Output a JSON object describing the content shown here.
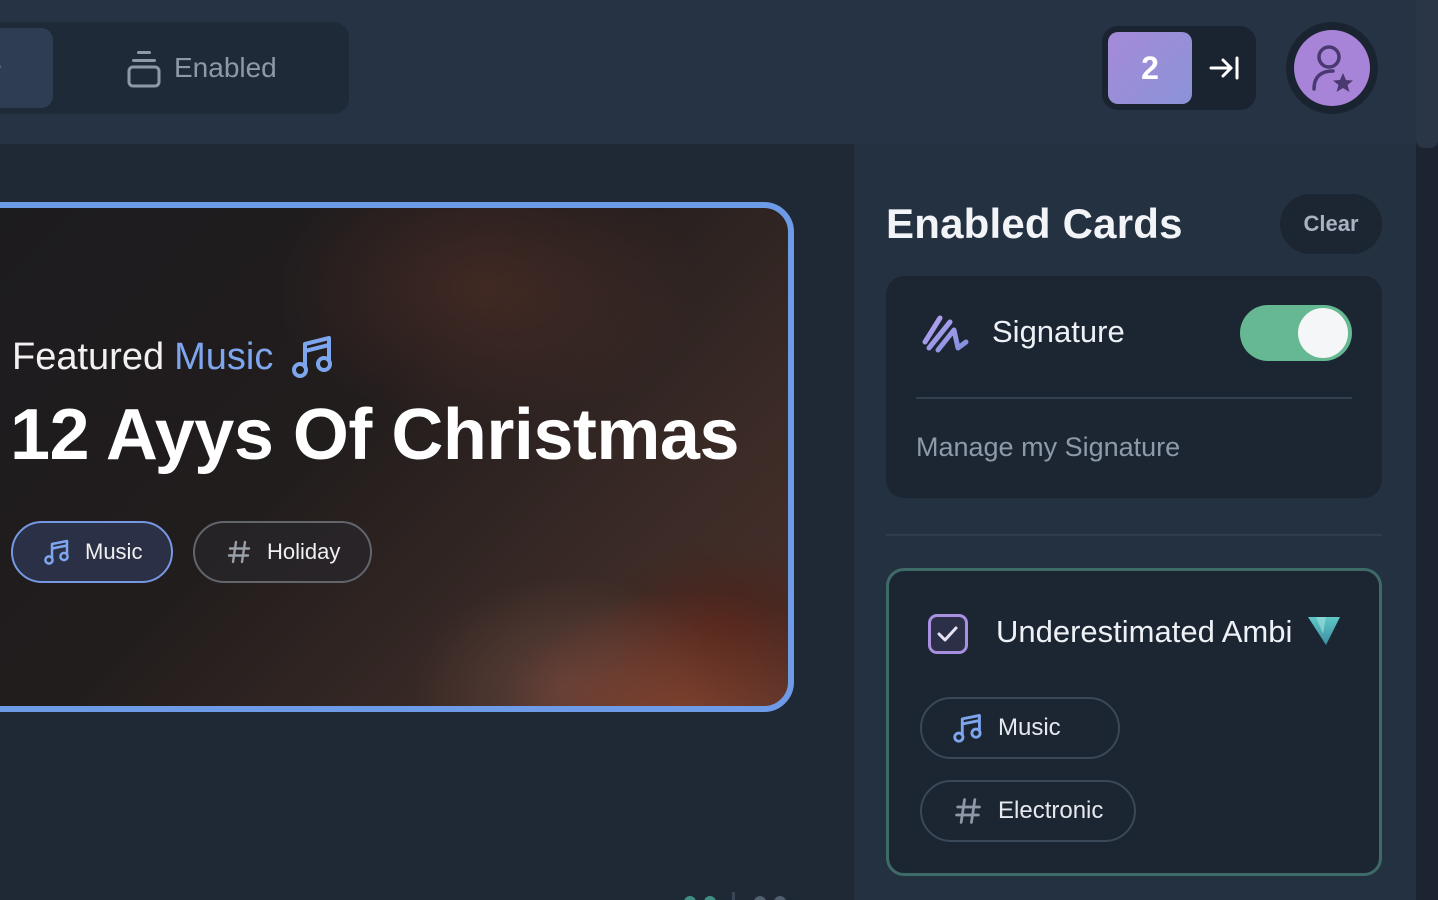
{
  "topbar": {
    "active_segment_fragment": "e",
    "enabled_label": "Enabled",
    "count": "2"
  },
  "featured": {
    "kicker_prefix": "Featured",
    "kicker_accent": "Music",
    "title": "12 Ayys Of Christmas",
    "tags": [
      {
        "label": "Music",
        "icon": "music-note-icon"
      },
      {
        "label": "Holiday",
        "icon": "hashtag-icon"
      }
    ]
  },
  "panel": {
    "title": "Enabled Cards",
    "clear_label": "Clear",
    "signature": {
      "label": "Signature",
      "enabled": true,
      "manage_label": "Manage my Signature"
    },
    "card": {
      "title": "Underestimated Ambi",
      "checked": true,
      "tags": [
        {
          "label": "Music",
          "icon": "music-note-icon"
        },
        {
          "label": "Electronic",
          "icon": "hashtag-icon"
        }
      ]
    }
  },
  "colors": {
    "accent_blue": "#6e9be8",
    "toggle_on": "#66b892",
    "avatar_purple": "#a884d8",
    "card_border_teal": "#3e6a67"
  }
}
